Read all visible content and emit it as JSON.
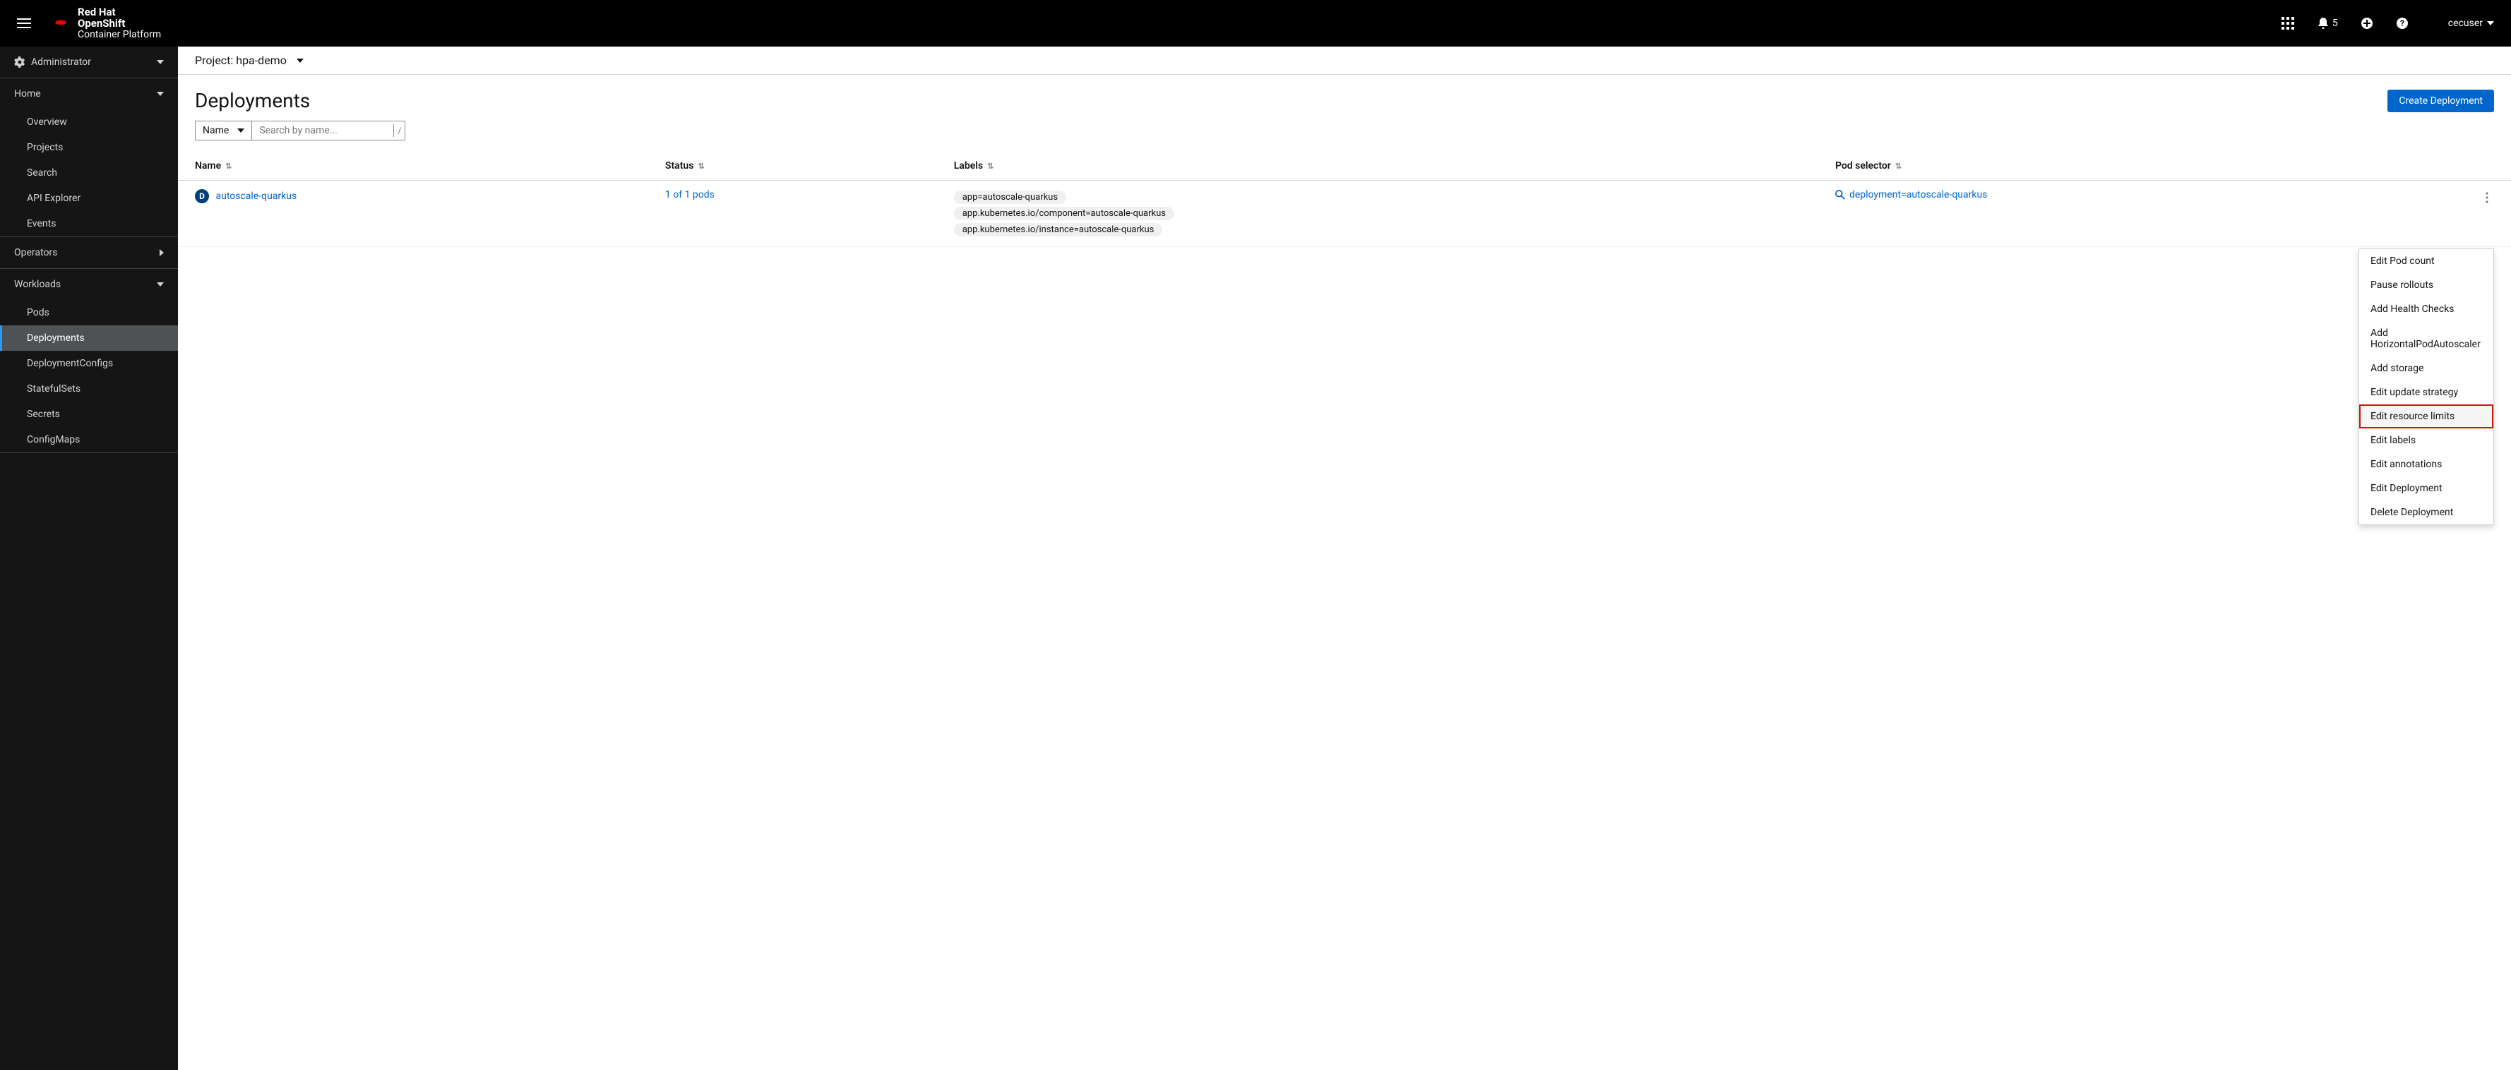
{
  "brand": {
    "line1": "Red Hat",
    "line2": "OpenShift",
    "line3": "Container Platform"
  },
  "header": {
    "notifications_count": "5",
    "user": "cecuser"
  },
  "sidebar": {
    "perspective": "Administrator",
    "home": {
      "label": "Home",
      "items": [
        "Overview",
        "Projects",
        "Search",
        "API Explorer",
        "Events"
      ]
    },
    "operators": {
      "label": "Operators"
    },
    "workloads": {
      "label": "Workloads",
      "items": [
        "Pods",
        "Deployments",
        "DeploymentConfigs",
        "StatefulSets",
        "Secrets",
        "ConfigMaps"
      ]
    }
  },
  "project": {
    "prefix": "Project:",
    "name": "hpa-demo"
  },
  "page": {
    "title": "Deployments",
    "create_button": "Create Deployment"
  },
  "filter": {
    "type": "Name",
    "placeholder": "Search by name...",
    "shortcut": "/"
  },
  "table": {
    "columns": {
      "name": "Name",
      "status": "Status",
      "labels": "Labels",
      "pod_selector": "Pod selector"
    },
    "rows": [
      {
        "badge": "D",
        "name": "autoscale-quarkus",
        "status": "1 of 1 pods",
        "labels": [
          "app=autoscale-quarkus",
          "app.kubernetes.io/component=autoscale-quarkus",
          "app.kubernetes.io/instance=autoscale-quarkus"
        ],
        "pod_selector": "deployment=autoscale-quarkus"
      }
    ]
  },
  "kebab_menu": [
    "Edit Pod count",
    "Pause rollouts",
    "Add Health Checks",
    "Add HorizontalPodAutoscaler",
    "Add storage",
    "Edit update strategy",
    "Edit resource limits",
    "Edit labels",
    "Edit annotations",
    "Edit Deployment",
    "Delete Deployment"
  ],
  "kebab_highlighted_index": 6
}
